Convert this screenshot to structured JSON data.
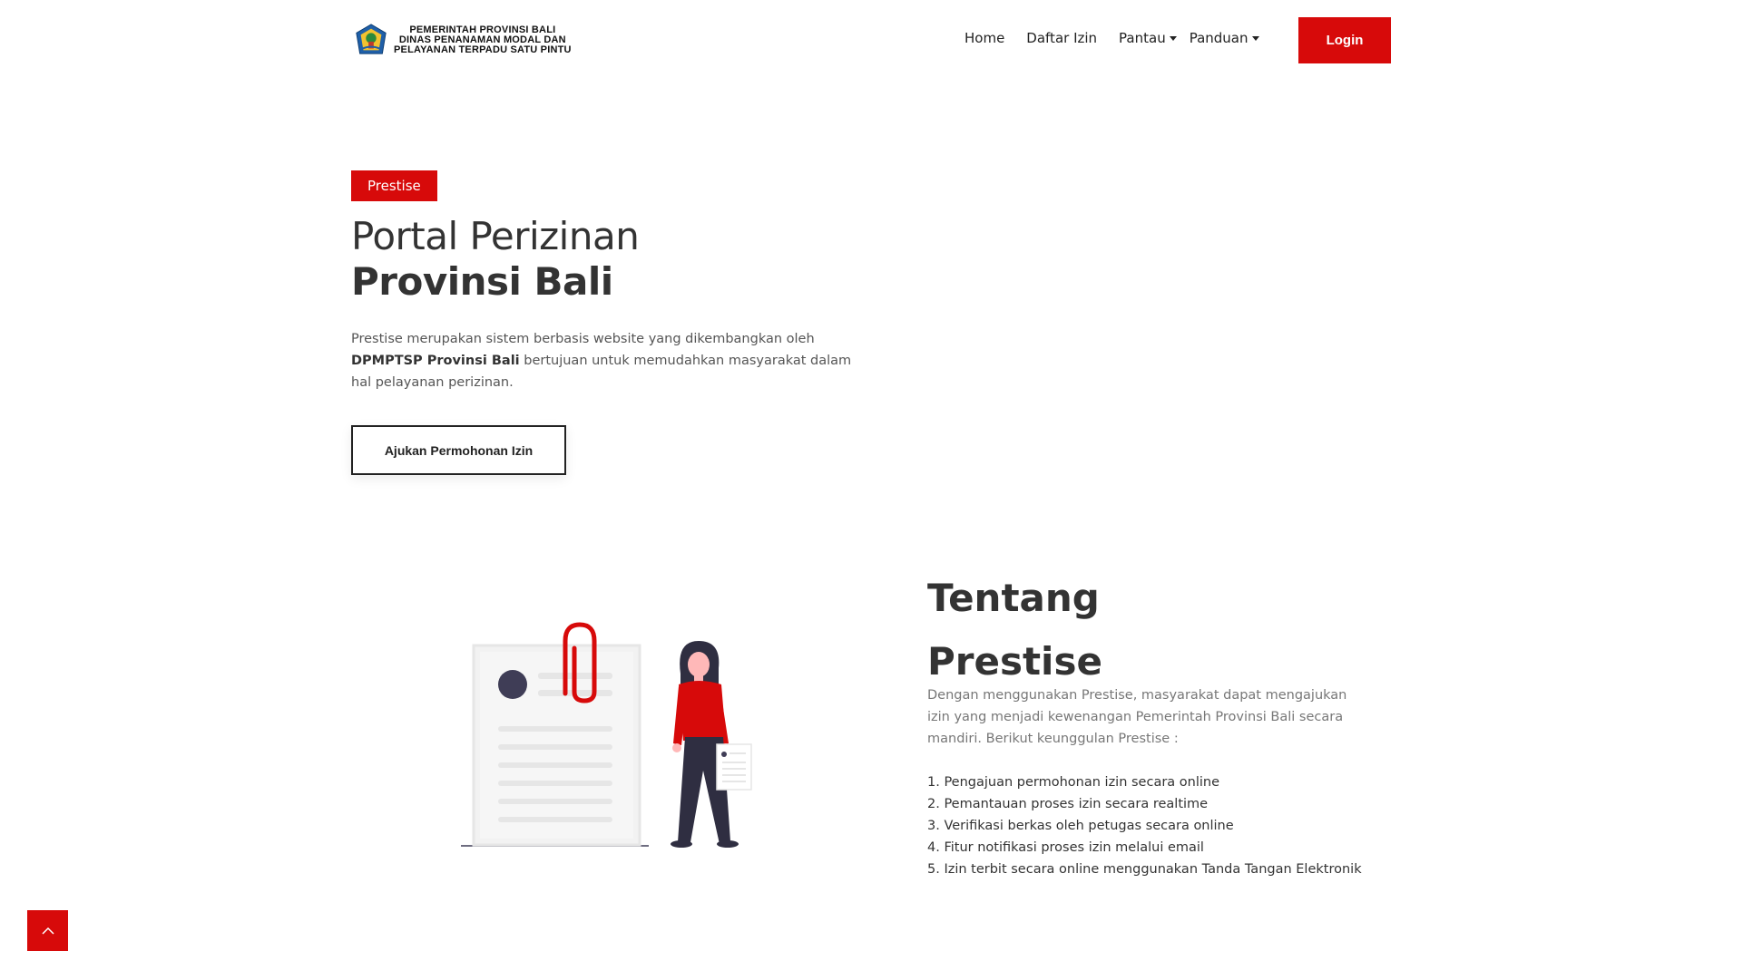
{
  "header": {
    "logo": {
      "line1": "PEMERINTAH PROVINSI BALI",
      "line2": "DINAS PENANAMAN MODAL DAN",
      "line3": "PELAYANAN TERPADU SATU PINTU"
    },
    "nav": {
      "home": "Home",
      "daftar_izin": "Daftar Izin",
      "pantau": "Pantau",
      "panduan": "Panduan"
    },
    "login_label": "Login"
  },
  "hero": {
    "badge": "Prestise",
    "title_line1": "Portal Perizinan",
    "title_line2": "Provinsi Bali",
    "desc_part1": "Prestise merupakan sistem berbasis website yang dikembangkan oleh ",
    "desc_bold": "DPMPTSP Provinsi Bali",
    "desc_part2": " bertujuan untuk memudahkan masyarakat dalam hal pelayanan perizinan.",
    "cta_label": "Ajukan Permohonan Izin"
  },
  "about": {
    "title_line1": "Tentang",
    "title_line2": "Prestise",
    "description": "Dengan menggunakan Prestise, masyarakat dapat mengajukan izin yang menjadi kewenangan Pemerintah Provinsi Bali secara mandiri. Berikut keunggulan Prestise :",
    "features": [
      "1. Pengajuan permohonan izin secara online",
      "2. Pemantauan proses izin secara realtime",
      "3. Verifikasi berkas oleh petugas secara online",
      "4. Fitur notifikasi proses izin melalui email",
      "5. Izin terbit secara online menggunakan Tanda Tangan Elektronik"
    ]
  },
  "colors": {
    "accent": "#d70a0a",
    "text_dark": "#333333",
    "text_muted": "#777777"
  },
  "icons": {
    "logo": "bali-province-emblem-icon",
    "back_to_top": "chevron-up-icon"
  }
}
